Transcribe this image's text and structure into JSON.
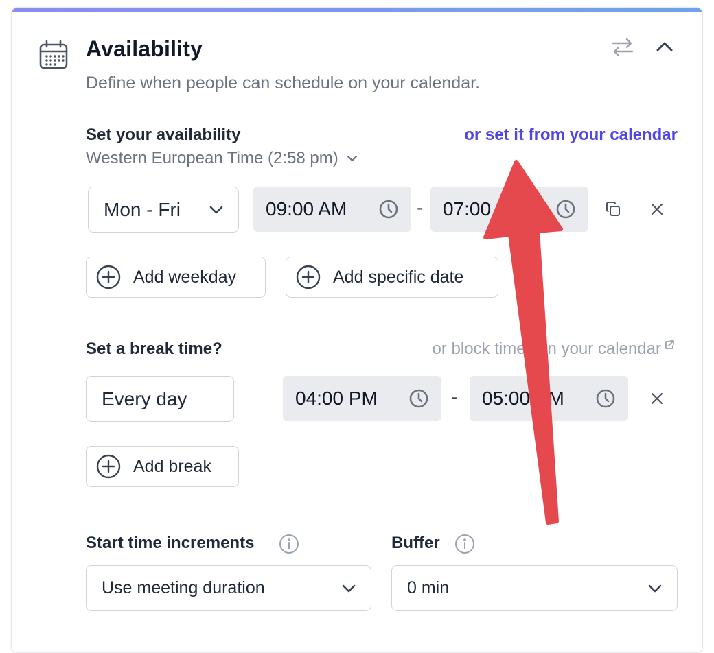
{
  "availability": {
    "title": "Availability",
    "subtitle": "Define when people can schedule on your calendar.",
    "set_label": "Set your availability",
    "calendar_link": "or set it from your calendar",
    "timezone": "Western European Time (2:58 pm)",
    "day_range": "Mon - Fri",
    "start_time": "09:00 AM",
    "end_time": "07:00 PM",
    "range_separator": "-",
    "add_weekday": "Add weekday",
    "add_specific_date": "Add specific date"
  },
  "break": {
    "label": "Set a break time?",
    "block_link": "or block times on your calendar",
    "day": "Every day",
    "start_time": "04:00 PM",
    "end_time": "05:00 PM",
    "range_separator": "-",
    "add_break": "Add break"
  },
  "increments": {
    "label": "Start time increments",
    "value": "Use meeting duration"
  },
  "buffer": {
    "label": "Buffer",
    "value": "0 min"
  },
  "colors": {
    "accent": "#4f46e5",
    "annotation_arrow": "#e5484d",
    "time_field_bg": "#e9ebef"
  }
}
